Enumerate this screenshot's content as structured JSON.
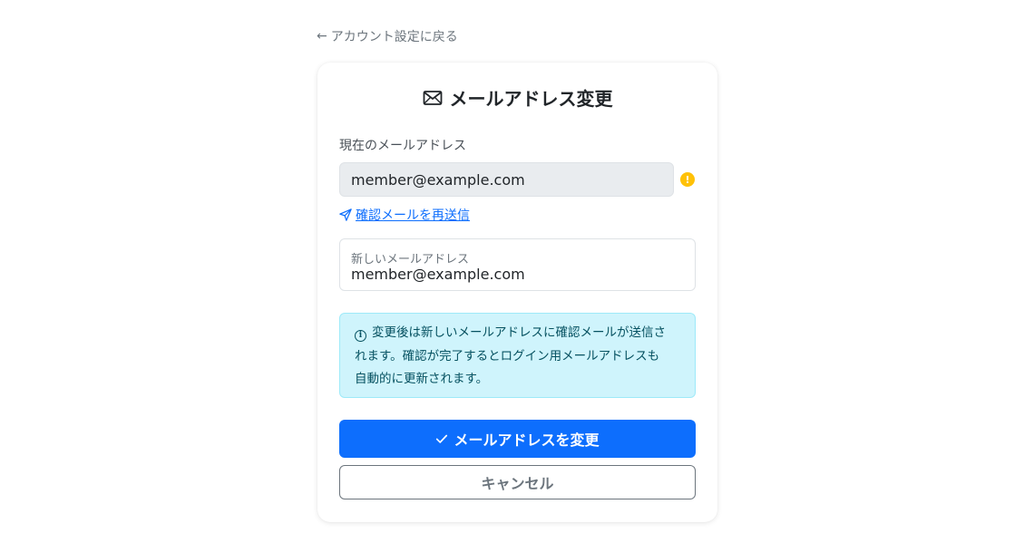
{
  "back_link": {
    "label": "アカウント設定に戻る",
    "icon": "arrow-left-icon"
  },
  "card": {
    "title": "メールアドレス変更",
    "title_icon": "envelope-icon",
    "current_label": "現在のメールアドレス",
    "current_email": "member@example.com",
    "warning_icon": "exclamation-circle-icon",
    "resend_label": "確認メールを再送信",
    "resend_icon": "send-icon",
    "new_email_label": "新しいメールアドレス",
    "new_email_value": "member@example.com",
    "info_icon": "info-circle-icon",
    "info_lines": [
      "変更後は新しいメールアドレスに確認メールが送信さ",
      "れます。確認が完了するとログイン用メールアドレスも",
      "自動的に更新されます。"
    ],
    "submit_label": "メールアドレスを変更",
    "submit_icon": "check-icon",
    "cancel_label": "キャンセル"
  },
  "colors": {
    "primary": "#0d6efd",
    "warning": "#ffc107",
    "info_bg": "#cff4fc",
    "info_text": "#055160",
    "readonly_bg": "#e9ecef"
  }
}
